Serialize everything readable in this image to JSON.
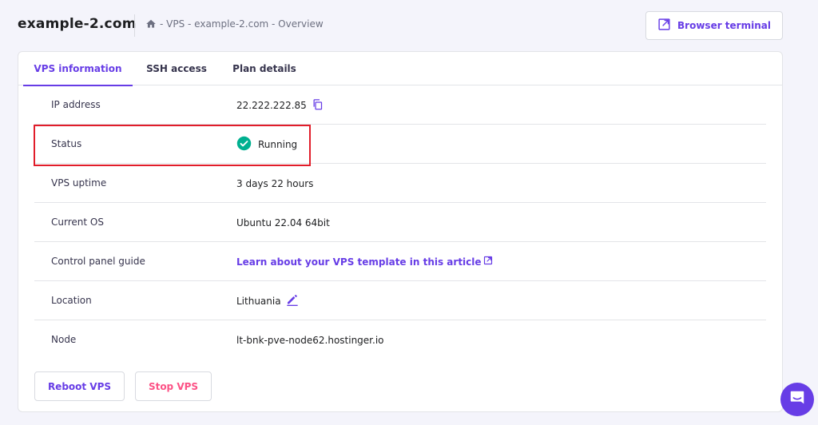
{
  "header": {
    "site_title": "example-2.com",
    "breadcrumb": "- VPS - example-2.com - Overview",
    "terminal_label": "Browser terminal"
  },
  "tabs": [
    {
      "label": "VPS information",
      "active": true
    },
    {
      "label": "SSH access",
      "active": false
    },
    {
      "label": "Plan details",
      "active": false
    }
  ],
  "info_rows": [
    {
      "label": "IP address",
      "value": "22.222.222.85"
    },
    {
      "label": "Status",
      "value": "Running"
    },
    {
      "label": "VPS uptime",
      "value": "3 days 22 hours"
    },
    {
      "label": "Current OS",
      "value": "Ubuntu 22.04 64bit"
    },
    {
      "label": "Control panel guide",
      "value": "Learn about your VPS template in this article"
    },
    {
      "label": "Location",
      "value": "Lithuania"
    },
    {
      "label": "Node",
      "value": "lt-bnk-pve-node62.hostinger.io"
    }
  ],
  "actions": {
    "reboot_label": "Reboot VPS",
    "stop_label": "Stop VPS"
  },
  "colors": {
    "accent": "#673de6",
    "running": "#00b090",
    "danger": "#fc5185",
    "highlight": "#e11d2a"
  },
  "icons": [
    "home-icon",
    "external-link-icon",
    "copy-icon",
    "check-circle-icon",
    "pencil-icon",
    "chat-icon"
  ]
}
